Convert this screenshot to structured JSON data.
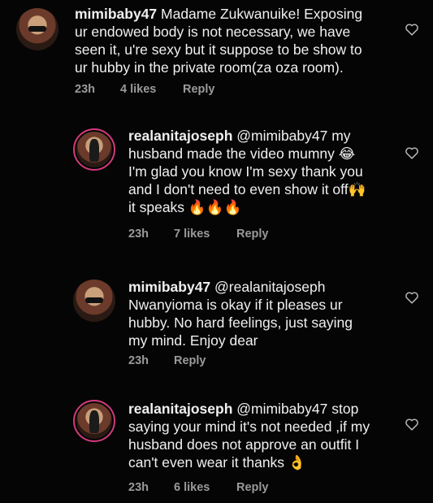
{
  "comments": [
    {
      "username": "mimibaby47",
      "line1_rest": " Madame Zukwanuike! Exposing",
      "line2": "ur endowed body is not necessary, we have",
      "line3": "seen it, u're sexy but it suppose to be show to",
      "line4": "ur hubby in the private room(za oza room).",
      "time": "23h",
      "likes": "4 likes",
      "reply": "Reply"
    },
    {
      "username": "realanitajoseph",
      "line1_rest": " @mimibaby47 my",
      "line2": "husband made the video mumny 😂",
      "line3": "I'm glad you know I'm sexy thank you",
      "line4": "and I don't need to even show it off🙌",
      "line5": "it speaks 🔥🔥🔥",
      "time": "23h",
      "likes": "7 likes",
      "reply": "Reply"
    },
    {
      "username": "mimibaby47",
      "line1_rest": " @realanitajoseph",
      "line2": "Nwanyioma is okay if it pleases ur",
      "line3": "hubby. No hard feelings, just saying",
      "line4": "my mind. Enjoy dear",
      "time": "23h",
      "reply": "Reply"
    },
    {
      "username": "realanitajoseph",
      "line1_rest": " @mimibaby47 stop",
      "line2": "saying your mind it's not needed ,if my",
      "line3": "husband does not approve an outfit I",
      "line4": "can't even wear it thanks 👌",
      "time": "23h",
      "likes": "6 likes",
      "reply": "Reply"
    }
  ],
  "colors": {
    "background": "#050505",
    "text": "#f0f0f0",
    "meta": "#9a9a9a",
    "story_ring": "#d13a7a"
  },
  "icons": {
    "like": "heart-outline-icon"
  }
}
